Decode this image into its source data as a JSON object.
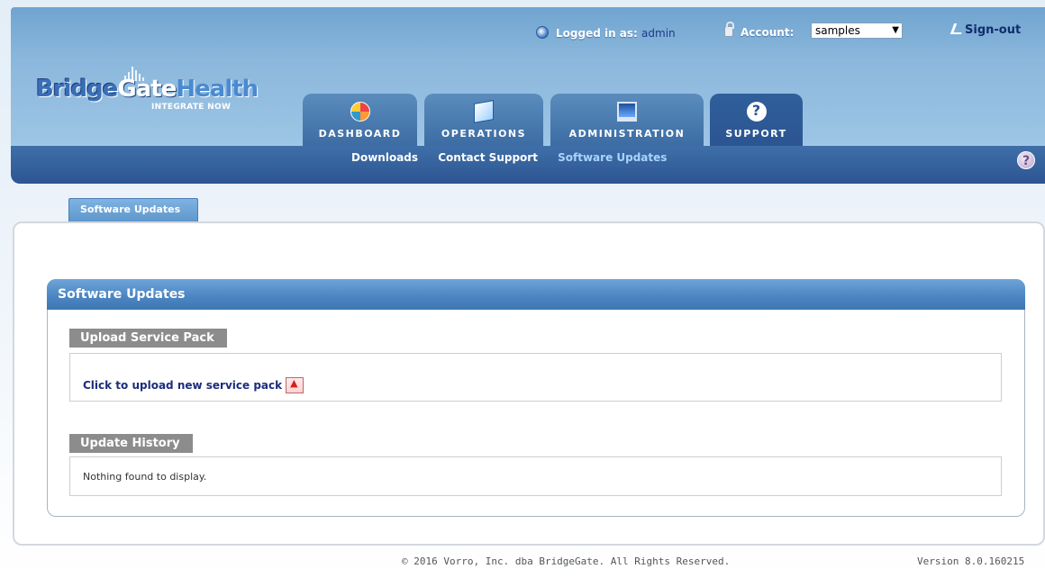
{
  "header": {
    "logged_in_label": "Logged in as:",
    "logged_in_user": "admin",
    "account_label": "Account:",
    "account_value": "samples",
    "signout_label": "Sign-out"
  },
  "logo": {
    "part1": "Bridge",
    "part2": "Gate",
    "part3": "Health",
    "tagline": "INTEGRATE NOW"
  },
  "tabs": [
    {
      "label": "DASHBOARD",
      "icon": "dashboard-icon"
    },
    {
      "label": "OPERATIONS",
      "icon": "operations-icon"
    },
    {
      "label": "ADMINISTRATION",
      "icon": "administration-icon"
    },
    {
      "label": "SUPPORT",
      "icon": "help-icon"
    }
  ],
  "subnav": [
    {
      "label": "Downloads"
    },
    {
      "label": "Contact Support"
    },
    {
      "label": "Software Updates"
    }
  ],
  "help_glyph": "?",
  "page_tab": {
    "label": "Software Updates"
  },
  "panel": {
    "title": "Software Updates",
    "upload_section": {
      "label": "Upload Service Pack",
      "link_text": "Click to upload new service pack"
    },
    "history_section": {
      "label": "Update History",
      "empty_text": "Nothing found to display."
    }
  },
  "footer": {
    "copyright": "© 2016 Vorro, Inc. dba BridgeGate. All Rights Reserved.",
    "version": "Version 8.0.160215"
  },
  "colors": {
    "header_blue": "#6fa4cf",
    "nav_bar": "#2c5592",
    "panel_header": "#4d87c3",
    "section_label": "#8c8c8c",
    "current_subnav": "#a9d4ff"
  }
}
